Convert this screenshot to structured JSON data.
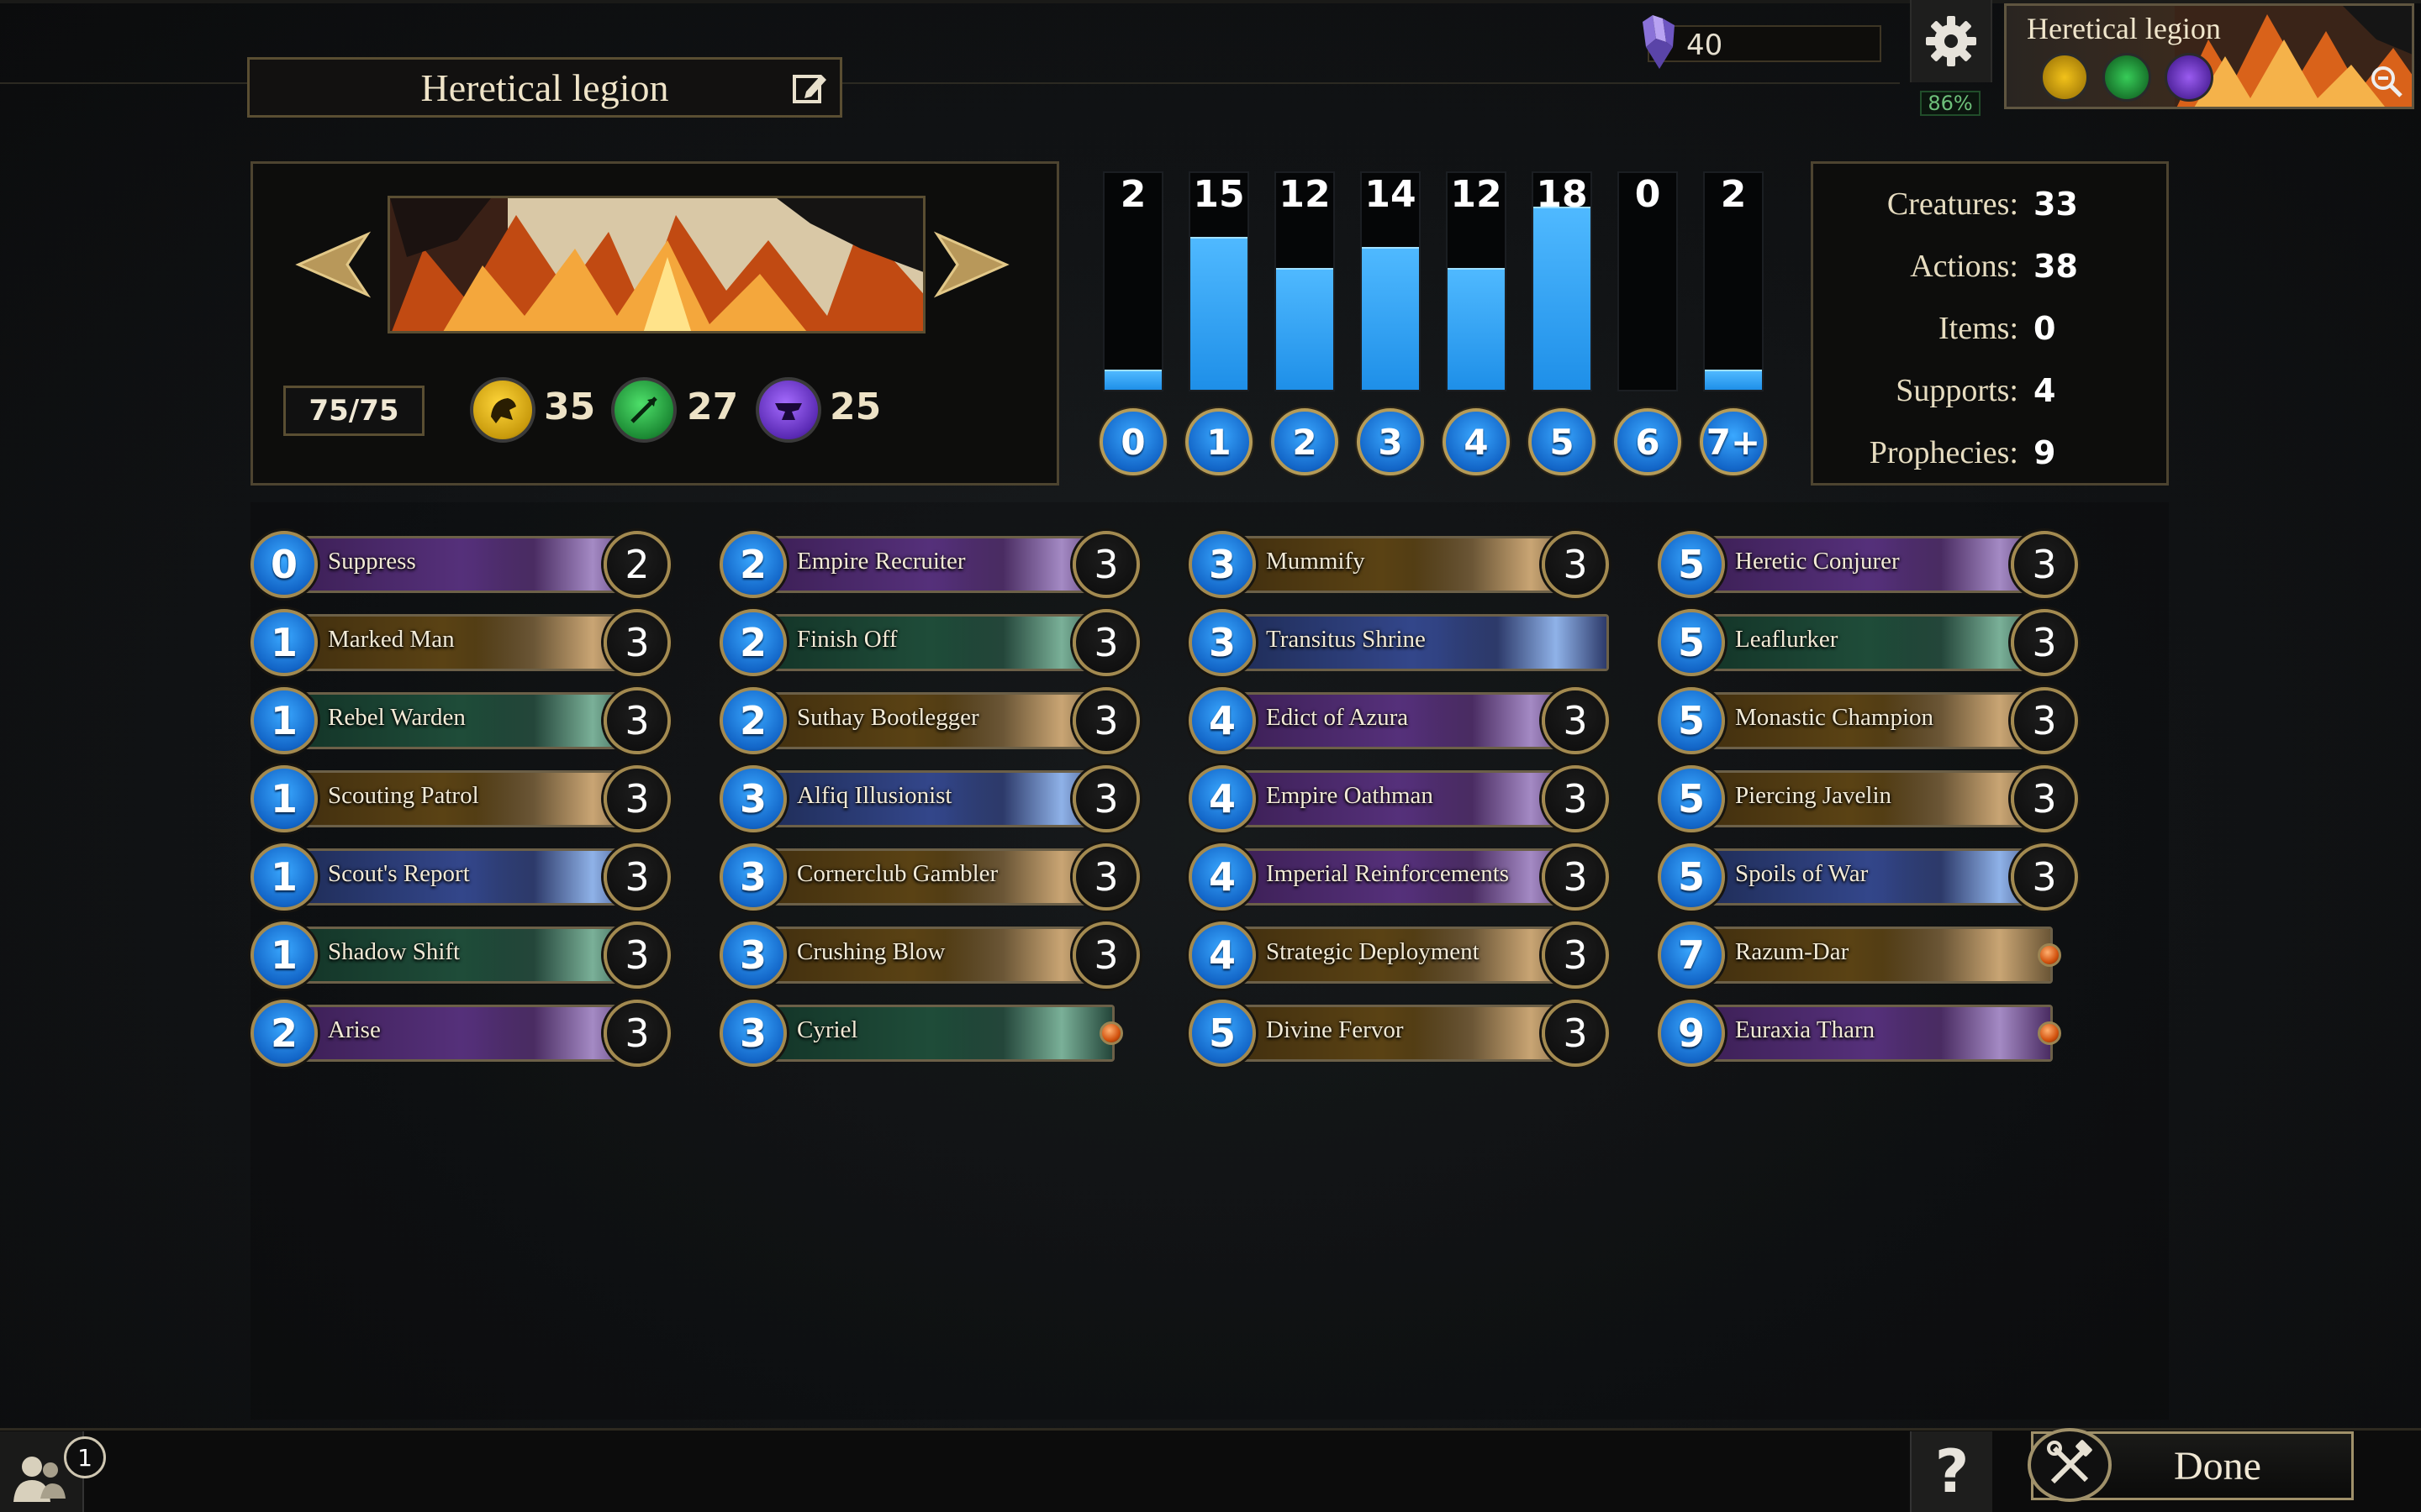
{
  "deck": {
    "title": "Heretical legion",
    "card_count": "75/75",
    "attributes": [
      {
        "name": "strength-icon",
        "color": "#f2c21a",
        "count": "35"
      },
      {
        "name": "agility-icon",
        "color": "#29b34a",
        "count": "27"
      },
      {
        "name": "endurance-icon",
        "color": "#7a3fd6",
        "count": "25"
      }
    ]
  },
  "header": {
    "gems": "40",
    "zoom": "86%",
    "mini_deck_title": "Heretical legion"
  },
  "magicka_curve": {
    "costs": [
      "0",
      "1",
      "2",
      "3",
      "4",
      "5",
      "6",
      "7+"
    ],
    "counts": [
      2,
      15,
      12,
      14,
      12,
      18,
      0,
      2
    ],
    "max": 18,
    "highlighted_index": 5
  },
  "stats": [
    {
      "label": "Creatures:",
      "value": "33"
    },
    {
      "label": "Actions:",
      "value": "38"
    },
    {
      "label": "Items:",
      "value": "0"
    },
    {
      "label": "Supports:",
      "value": "4"
    },
    {
      "label": "Prophecies:",
      "value": "9"
    }
  ],
  "cards": [
    [
      {
        "cost": "0",
        "name": "Suppress",
        "qty": "2",
        "attr": "endurance"
      },
      {
        "cost": "1",
        "name": "Marked Man",
        "qty": "3",
        "attr": "strength"
      },
      {
        "cost": "1",
        "name": "Rebel Warden",
        "qty": "3",
        "attr": "agility"
      },
      {
        "cost": "1",
        "name": "Scouting Patrol",
        "qty": "3",
        "attr": "strength"
      },
      {
        "cost": "1",
        "name": "Scout's Report",
        "qty": "3",
        "attr": "intelligence"
      },
      {
        "cost": "1",
        "name": "Shadow Shift",
        "qty": "3",
        "attr": "agility"
      },
      {
        "cost": "2",
        "name": "Arise",
        "qty": "3",
        "attr": "endurance"
      }
    ],
    [
      {
        "cost": "2",
        "name": "Empire Recruiter",
        "qty": "3",
        "attr": "endurance"
      },
      {
        "cost": "2",
        "name": "Finish Off",
        "qty": "3",
        "attr": "agility"
      },
      {
        "cost": "2",
        "name": "Suthay Bootlegger",
        "qty": "3",
        "attr": "strength"
      },
      {
        "cost": "3",
        "name": "Alfiq Illusionist",
        "qty": "3",
        "attr": "intelligence"
      },
      {
        "cost": "3",
        "name": "Cornerclub Gambler",
        "qty": "3",
        "attr": "strength"
      },
      {
        "cost": "3",
        "name": "Crushing Blow",
        "qty": "3",
        "attr": "strength"
      },
      {
        "cost": "3",
        "name": "Cyriel",
        "qty": "",
        "attr": "agility",
        "unique": true
      }
    ],
    [
      {
        "cost": "3",
        "name": "Mummify",
        "qty": "3",
        "attr": "strength"
      },
      {
        "cost": "3",
        "name": "Transitus Shrine",
        "qty": "",
        "attr": "intelligence"
      },
      {
        "cost": "4",
        "name": "Edict of Azura",
        "qty": "3",
        "attr": "endurance"
      },
      {
        "cost": "4",
        "name": "Empire Oathman",
        "qty": "3",
        "attr": "endurance"
      },
      {
        "cost": "4",
        "name": "Imperial Reinforcements",
        "qty": "3",
        "attr": "endurance"
      },
      {
        "cost": "4",
        "name": "Strategic Deployment",
        "qty": "3",
        "attr": "strength"
      },
      {
        "cost": "5",
        "name": "Divine Fervor",
        "qty": "3",
        "attr": "strength"
      }
    ],
    [
      {
        "cost": "5",
        "name": "Heretic Conjurer",
        "qty": "3",
        "attr": "endurance"
      },
      {
        "cost": "5",
        "name": "Leaflurker",
        "qty": "3",
        "attr": "agility"
      },
      {
        "cost": "5",
        "name": "Monastic Champion",
        "qty": "3",
        "attr": "strength"
      },
      {
        "cost": "5",
        "name": "Piercing Javelin",
        "qty": "3",
        "attr": "strength"
      },
      {
        "cost": "5",
        "name": "Spoils of War",
        "qty": "3",
        "attr": "intelligence"
      },
      {
        "cost": "7",
        "name": "Razum-Dar",
        "qty": "",
        "attr": "strength",
        "unique": true
      },
      {
        "cost": "9",
        "name": "Euraxia Tharn",
        "qty": "",
        "attr": "endurance",
        "unique": true
      }
    ]
  ],
  "footer": {
    "friends_count": "1",
    "help_label": "?",
    "done_label": "Done"
  }
}
